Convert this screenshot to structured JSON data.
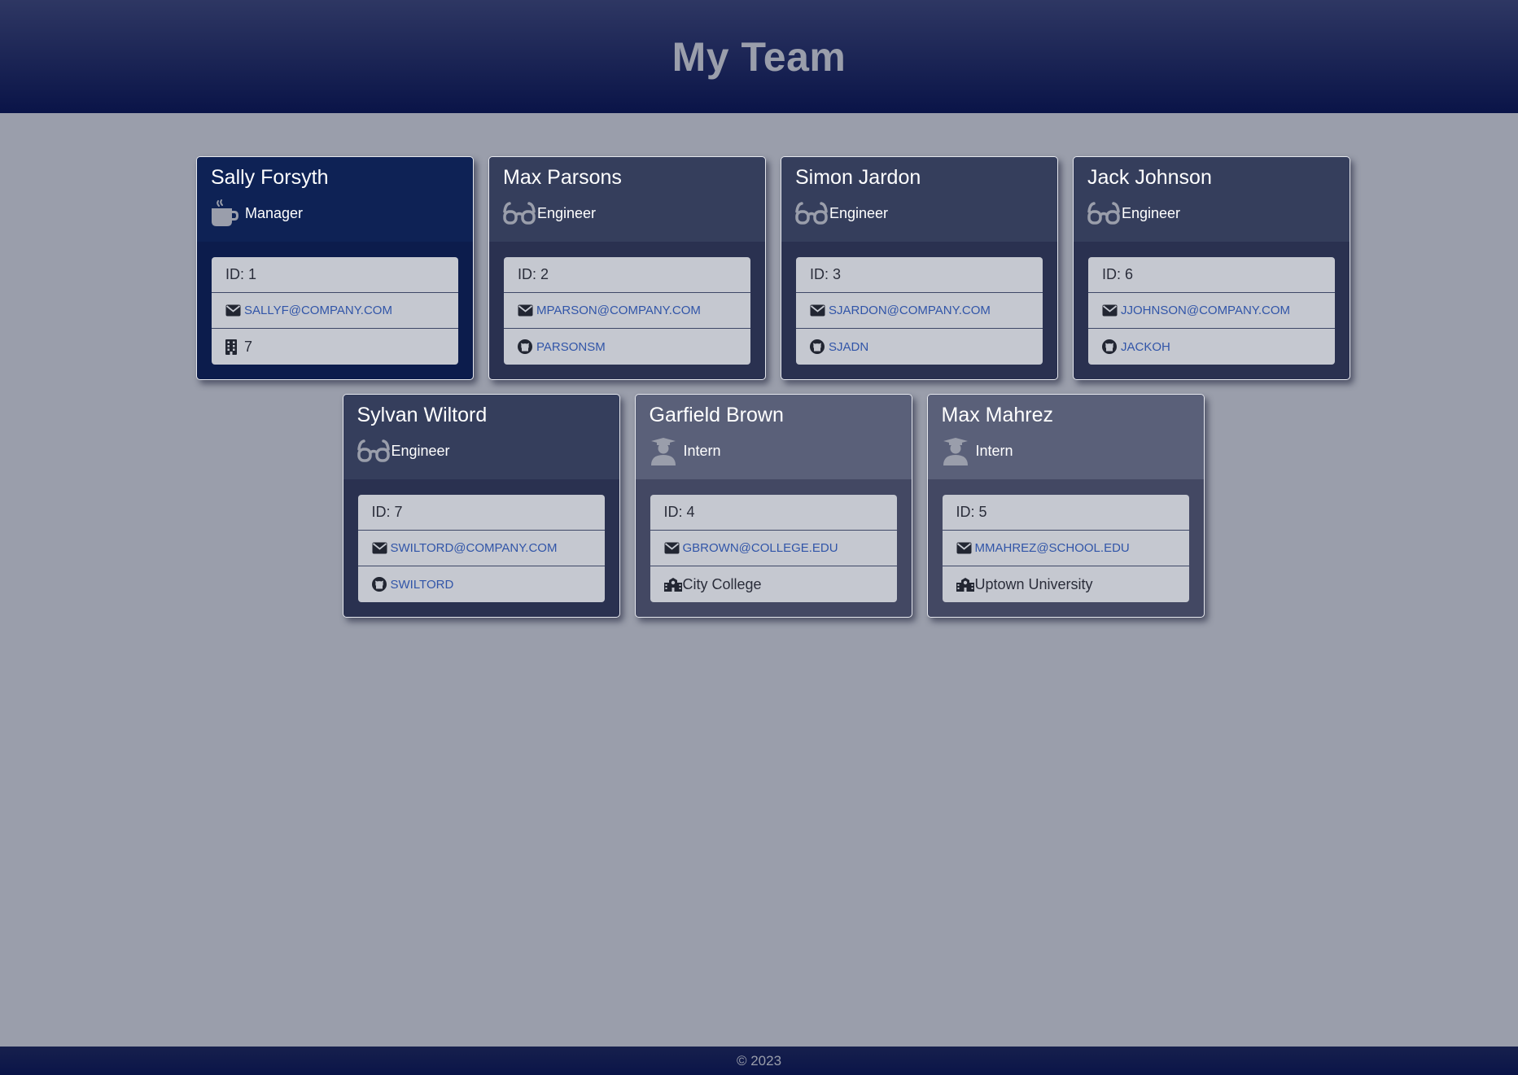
{
  "page": {
    "title": "My Team"
  },
  "footer": {
    "text": "© 2023"
  },
  "colors": {
    "header_background": "#0a1448",
    "page_background": "#9a9eab",
    "manager_card": "#0e2255",
    "engineer_card": "#353e5c",
    "intern_card": "#5a6079",
    "link": "#3155a8"
  },
  "team": [
    {
      "name": "Sally Forsyth",
      "role": "Manager",
      "role_icon": "coffee-mug-icon",
      "id_label": "ID: 1",
      "email": "SALLYF@COMPANY.COM",
      "extra_icon": "building-icon",
      "extra": "7",
      "extra_is_link": false
    },
    {
      "name": "Max Parsons",
      "role": "Engineer",
      "role_icon": "glasses-icon",
      "id_label": "ID: 2",
      "email": "MPARSON@COMPANY.COM",
      "extra_icon": "github-icon",
      "extra": "PARSONSM",
      "extra_is_link": true
    },
    {
      "name": "Simon Jardon",
      "role": "Engineer",
      "role_icon": "glasses-icon",
      "id_label": "ID: 3",
      "email": "SJARDON@COMPANY.COM",
      "extra_icon": "github-icon",
      "extra": "SJADN",
      "extra_is_link": true
    },
    {
      "name": "Jack Johnson",
      "role": "Engineer",
      "role_icon": "glasses-icon",
      "id_label": "ID: 6",
      "email": "JJOHNSON@COMPANY.COM",
      "extra_icon": "github-icon",
      "extra": "JACKOH",
      "extra_is_link": true
    },
    {
      "name": "Sylvan Wiltord",
      "role": "Engineer",
      "role_icon": "glasses-icon",
      "id_label": "ID: 7",
      "email": "SWILTORD@COMPANY.COM",
      "extra_icon": "github-icon",
      "extra": "SWILTORD",
      "extra_is_link": true
    },
    {
      "name": "Garfield Brown",
      "role": "Intern",
      "role_icon": "graduate-icon",
      "id_label": "ID: 4",
      "email": "GBROWN@COLLEGE.EDU",
      "extra_icon": "school-icon",
      "extra": "City College",
      "extra_is_link": false
    },
    {
      "name": "Max Mahrez",
      "role": "Intern",
      "role_icon": "graduate-icon",
      "id_label": "ID: 5",
      "email": "MMAHREZ@SCHOOL.EDU",
      "extra_icon": "school-icon",
      "extra": "Uptown University",
      "extra_is_link": false
    }
  ]
}
